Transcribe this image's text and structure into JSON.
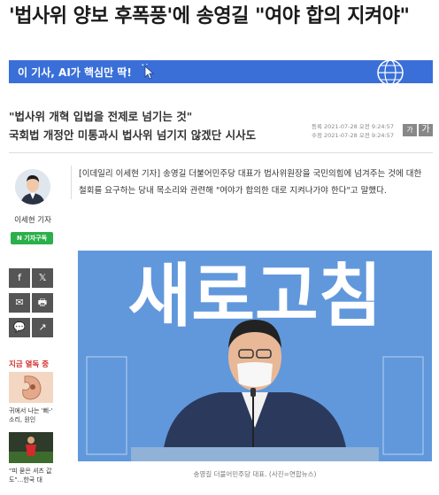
{
  "headline": "'법사위 양보 후폭풍'에 송영길 \"여야 합의 지켜야\"",
  "ai_banner": {
    "text": "이 기사, AI가 핵심만 딱!",
    "bg": "#3a6fd8"
  },
  "subtitles": [
    "\"법사위 개혁 입법을 전제로 넘기는 것\"",
    "국회법 개정안 미통과시 법사위 넘기지 않겠단 시사도"
  ],
  "dates": {
    "registered": "등록 2021-07-28 오전 9:24:57",
    "modified": "수정 2021-07-28 오전 9:24:57"
  },
  "font_buttons": [
    "가",
    "가"
  ],
  "sidebar": {
    "reporter_name": "이세현 기자",
    "subscribe_label": "N 기자구독",
    "share_icons": [
      "f",
      "𝕏",
      "✉",
      "🖶",
      "💬",
      "↗"
    ],
    "trending_title": "지금 열독 중",
    "trending_items": [
      {
        "caption": "귀에서 나는 '삐-' 소리, 원인"
      },
      {
        "caption": "\"피 묻은 셔츠 값도\"...한국 대"
      }
    ]
  },
  "article": {
    "body": "[이데일리 이세현 기자] 송영길 더불어민주당 대표가 법사위원장을 국민의힘에 넘겨주는 것에 대한 철회를 요구하는 당내 목소리와 관련해 \"여야가 합의한 대로 지켜나가야 한다\"고 말했다.",
    "backdrop_text": "새로고침",
    "photo_caption": "송영길 더불어민주당 대표. (사진=연합뉴스)"
  }
}
